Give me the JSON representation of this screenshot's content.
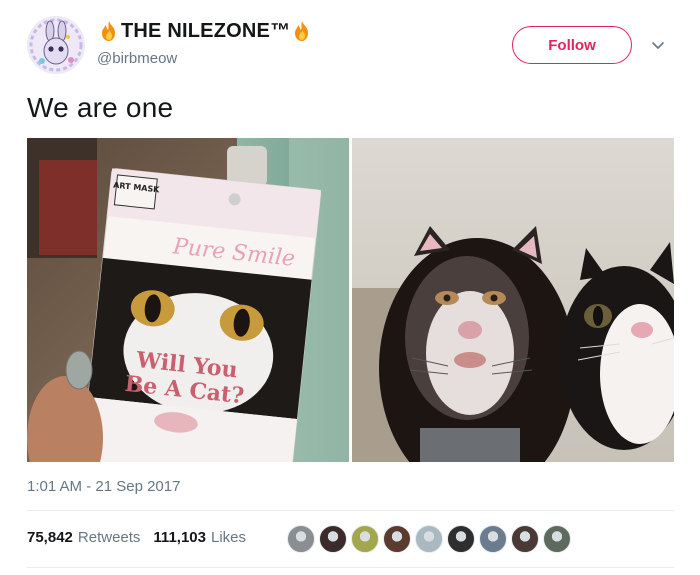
{
  "header": {
    "display_name": "THE NILEZONE™",
    "handle": "@birbmeow",
    "follow_label": "Follow",
    "name_emoji": "fire-icon"
  },
  "tweet": {
    "text": "We are one",
    "timestamp": "1:01 AM - 21 Sep 2017"
  },
  "images": {
    "left": {
      "package_brand": "Pure Smile",
      "package_badge": "ART MASK",
      "package_headline_line1": "Will You",
      "package_headline_line2": "Be A Cat?"
    }
  },
  "stats": {
    "retweets_count": "75,842",
    "retweets_label": "Retweets",
    "likes_count": "111,103",
    "likes_label": "Likes"
  },
  "likers": [
    "#8a8d91",
    "#3b2b2b",
    "#a2a64c",
    "#5a3b2e",
    "#aab8c2",
    "#2e2e2e",
    "#6b7c8f",
    "#4a3a35",
    "#5f6a5e"
  ],
  "colors": {
    "follow_accent": "#e0245e",
    "secondary_text": "#657786",
    "primary_text": "#14171a"
  }
}
